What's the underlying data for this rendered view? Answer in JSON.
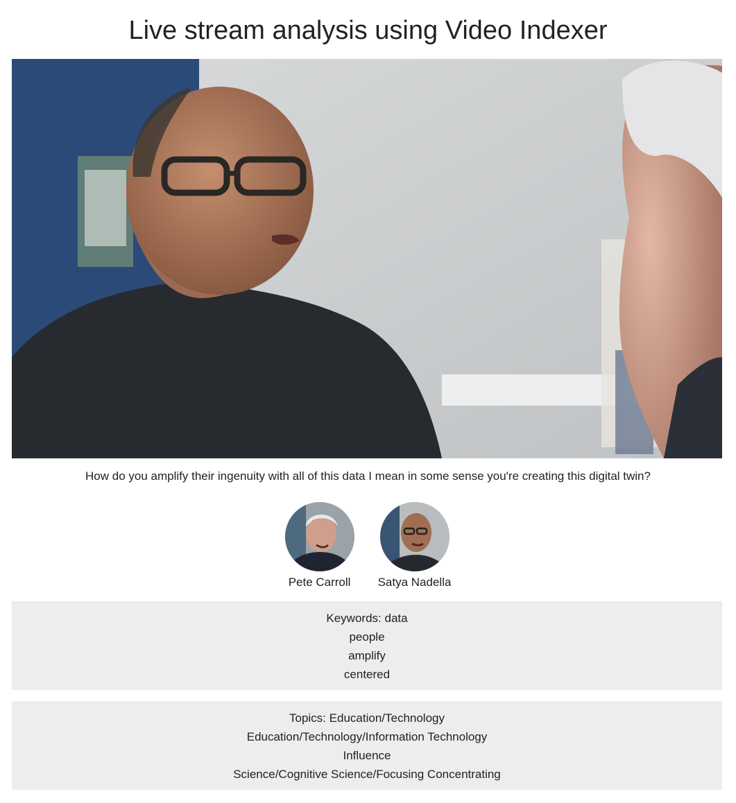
{
  "page": {
    "title": "Live stream analysis using Video Indexer"
  },
  "video": {
    "caption": "How do you amplify their ingenuity with all of this data I mean in some sense you're creating this digital twin?"
  },
  "people": [
    {
      "name": "Pete Carroll",
      "avatar_icon": "person-face-icon"
    },
    {
      "name": "Satya Nadella",
      "avatar_icon": "person-face-icon"
    }
  ],
  "keywords": {
    "label": "Keywords:",
    "items": [
      "data",
      "people",
      "amplify",
      "centered"
    ]
  },
  "topics": {
    "label": "Topics:",
    "items": [
      "Education/Technology",
      "Education/Technology/Information Technology",
      "Influence",
      "Science/Cognitive Science/Focusing Concentrating"
    ]
  },
  "colors": {
    "panel_background": "#ededed",
    "text": "#222222",
    "page_background": "#ffffff"
  }
}
